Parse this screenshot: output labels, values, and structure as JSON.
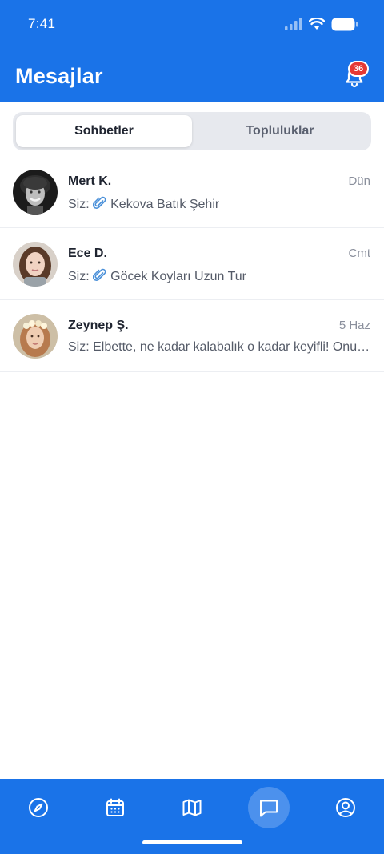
{
  "status_bar": {
    "time": "7:41"
  },
  "header": {
    "title": "Mesajlar",
    "notification_count": "36"
  },
  "tabs": [
    {
      "label": "Sohbetler",
      "active": true
    },
    {
      "label": "Topluluklar",
      "active": false
    }
  ],
  "chats": [
    {
      "name": "Mert K.",
      "time": "Dün",
      "prefix": "Siz:",
      "has_attachment": true,
      "preview": "Kekova Batık Şehir"
    },
    {
      "name": "Ece D.",
      "time": "Cmt",
      "prefix": "Siz:",
      "has_attachment": true,
      "preview": "Göcek Koyları Uzun Tur"
    },
    {
      "name": "Zeynep Ş.",
      "time": "5 Haz",
      "prefix": "Siz:",
      "has_attachment": false,
      "preview": "Elbette, ne kadar kalabalık o kadar keyifli! Onu ..."
    }
  ],
  "bottom_nav": [
    {
      "icon": "compass-icon",
      "active": false
    },
    {
      "icon": "calendar-icon",
      "active": false
    },
    {
      "icon": "map-icon",
      "active": false
    },
    {
      "icon": "chat-icon",
      "active": true
    },
    {
      "icon": "profile-icon",
      "active": false
    }
  ],
  "colors": {
    "primary": "#1a73e8",
    "badge": "#e53935",
    "muted": "#8a8f9c"
  }
}
